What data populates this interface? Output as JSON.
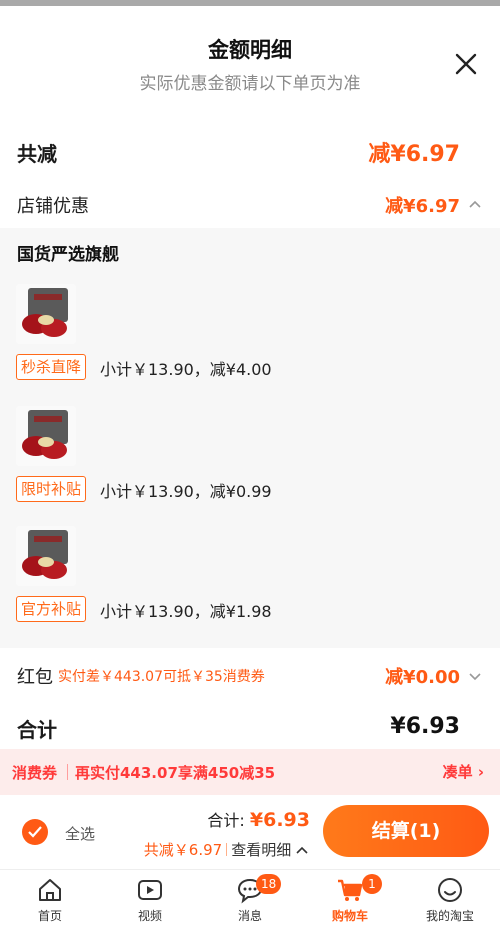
{
  "sheet": {
    "title": "金额明细",
    "subtitle": "实际优惠金额请以下单页为准"
  },
  "summary": {
    "total_reduction_label": "共减",
    "total_reduction_value": "减¥6.97",
    "shop_discount_label": "店铺优惠",
    "shop_discount_value": "减¥6.97"
  },
  "store": {
    "name": "国货严选旗舰",
    "items": [
      {
        "tag": "秒杀直降",
        "subtotal": "小计￥13.90，减¥4.00"
      },
      {
        "tag": "限时补贴",
        "subtotal": "小计￥13.90，减¥0.99"
      },
      {
        "tag": "官方补贴",
        "subtotal": "小计￥13.90，减¥1.98"
      }
    ]
  },
  "red_packet": {
    "label": "红包",
    "note": "实付差￥443.07可抵￥35消费券",
    "value": "减¥0.00"
  },
  "total": {
    "label": "合计",
    "value": "¥6.93"
  },
  "coupon_bar": {
    "label": "消费券",
    "text": "再实付443.07享满450减35",
    "action": "凑单 ›"
  },
  "checkout": {
    "select_all": "全选",
    "sum_label": "合计:",
    "sum_value": "¥6.93",
    "discount_text": "共减￥6.97",
    "detail_link": "查看明细",
    "pay_button": "结算(1)"
  },
  "tabbar": [
    {
      "label": "首页",
      "icon": "home-icon"
    },
    {
      "label": "视频",
      "icon": "video-icon"
    },
    {
      "label": "消息",
      "icon": "message-icon",
      "badge": "18"
    },
    {
      "label": "购物车",
      "icon": "cart-icon",
      "badge": "1",
      "active": true
    },
    {
      "label": "我的淘宝",
      "icon": "profile-icon"
    }
  ],
  "colors": {
    "accent": "#ff5a14",
    "coupon_red": "#ff3a3a",
    "panel_bg": "#f7f7f7"
  }
}
